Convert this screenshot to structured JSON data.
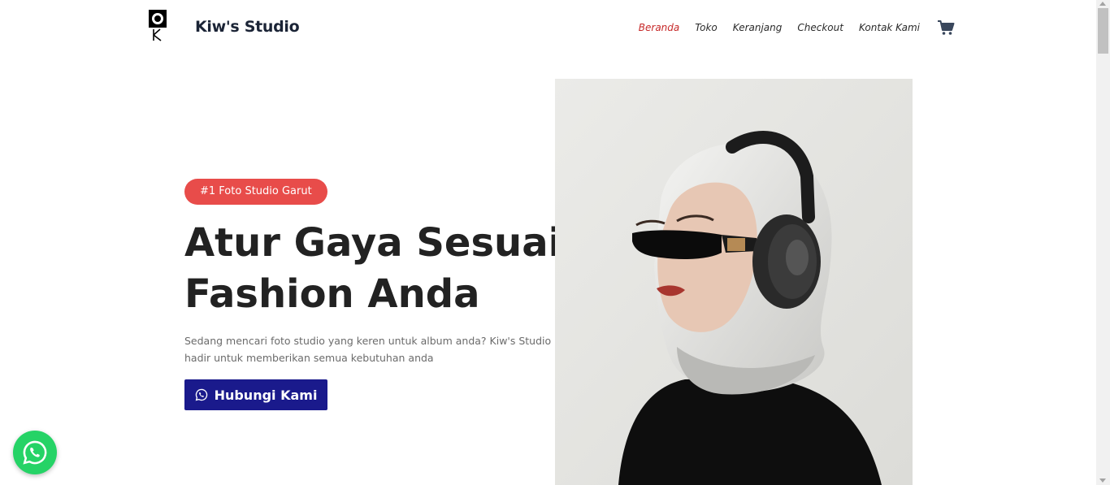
{
  "header": {
    "brand": "Kiw's Studio",
    "nav": [
      {
        "label": "Beranda",
        "active": true
      },
      {
        "label": "Toko",
        "active": false
      },
      {
        "label": "Keranjang",
        "active": false
      },
      {
        "label": "Checkout",
        "active": false
      },
      {
        "label": "Kontak Kami",
        "active": false
      }
    ],
    "cart_icon": "shopping-cart-icon",
    "logo_icon": "camera-k-logo"
  },
  "hero": {
    "badge": "#1 Foto Studio Garut",
    "headline_line1": "Atur Gaya Sesuai",
    "headline_line2": "Fashion Anda",
    "description": "Sedang mencari foto studio yang keren untuk album anda? Kiw's Studio hadir untuk memberikan semua kebutuhan anda",
    "cta_label": "Hubungi Kami",
    "cta_icon": "whatsapp-icon",
    "image_icon": "hero-model-photo"
  },
  "floating": {
    "icon": "whatsapp-icon"
  },
  "colors": {
    "accent_red": "#e84c4a",
    "nav_active": "#c62828",
    "cta_bg": "#1a1a8c",
    "whatsapp_green": "#25d366",
    "brand_text": "#1b2436"
  }
}
